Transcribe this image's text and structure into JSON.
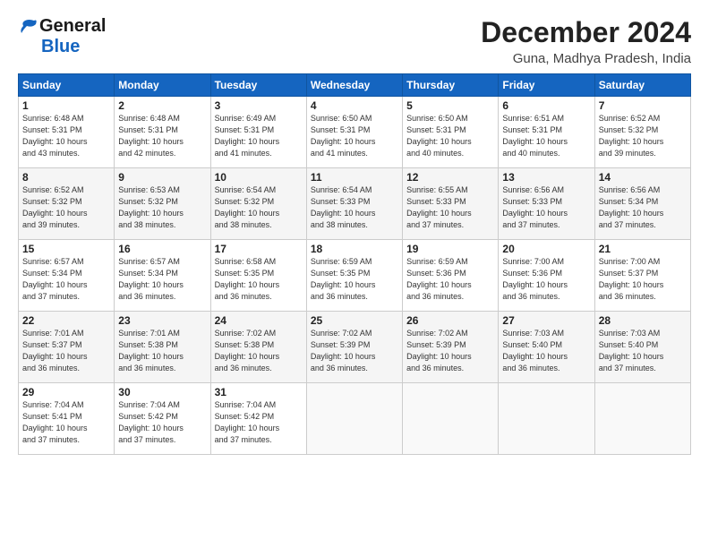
{
  "logo": {
    "line1": "General",
    "line2": "Blue"
  },
  "title": "December 2024",
  "subtitle": "Guna, Madhya Pradesh, India",
  "days_header": [
    "Sunday",
    "Monday",
    "Tuesday",
    "Wednesday",
    "Thursday",
    "Friday",
    "Saturday"
  ],
  "weeks": [
    [
      {
        "day": "1",
        "info": "Sunrise: 6:48 AM\nSunset: 5:31 PM\nDaylight: 10 hours\nand 43 minutes."
      },
      {
        "day": "2",
        "info": "Sunrise: 6:48 AM\nSunset: 5:31 PM\nDaylight: 10 hours\nand 42 minutes."
      },
      {
        "day": "3",
        "info": "Sunrise: 6:49 AM\nSunset: 5:31 PM\nDaylight: 10 hours\nand 41 minutes."
      },
      {
        "day": "4",
        "info": "Sunrise: 6:50 AM\nSunset: 5:31 PM\nDaylight: 10 hours\nand 41 minutes."
      },
      {
        "day": "5",
        "info": "Sunrise: 6:50 AM\nSunset: 5:31 PM\nDaylight: 10 hours\nand 40 minutes."
      },
      {
        "day": "6",
        "info": "Sunrise: 6:51 AM\nSunset: 5:31 PM\nDaylight: 10 hours\nand 40 minutes."
      },
      {
        "day": "7",
        "info": "Sunrise: 6:52 AM\nSunset: 5:32 PM\nDaylight: 10 hours\nand 39 minutes."
      }
    ],
    [
      {
        "day": "8",
        "info": "Sunrise: 6:52 AM\nSunset: 5:32 PM\nDaylight: 10 hours\nand 39 minutes."
      },
      {
        "day": "9",
        "info": "Sunrise: 6:53 AM\nSunset: 5:32 PM\nDaylight: 10 hours\nand 38 minutes."
      },
      {
        "day": "10",
        "info": "Sunrise: 6:54 AM\nSunset: 5:32 PM\nDaylight: 10 hours\nand 38 minutes."
      },
      {
        "day": "11",
        "info": "Sunrise: 6:54 AM\nSunset: 5:33 PM\nDaylight: 10 hours\nand 38 minutes."
      },
      {
        "day": "12",
        "info": "Sunrise: 6:55 AM\nSunset: 5:33 PM\nDaylight: 10 hours\nand 37 minutes."
      },
      {
        "day": "13",
        "info": "Sunrise: 6:56 AM\nSunset: 5:33 PM\nDaylight: 10 hours\nand 37 minutes."
      },
      {
        "day": "14",
        "info": "Sunrise: 6:56 AM\nSunset: 5:34 PM\nDaylight: 10 hours\nand 37 minutes."
      }
    ],
    [
      {
        "day": "15",
        "info": "Sunrise: 6:57 AM\nSunset: 5:34 PM\nDaylight: 10 hours\nand 37 minutes."
      },
      {
        "day": "16",
        "info": "Sunrise: 6:57 AM\nSunset: 5:34 PM\nDaylight: 10 hours\nand 36 minutes."
      },
      {
        "day": "17",
        "info": "Sunrise: 6:58 AM\nSunset: 5:35 PM\nDaylight: 10 hours\nand 36 minutes."
      },
      {
        "day": "18",
        "info": "Sunrise: 6:59 AM\nSunset: 5:35 PM\nDaylight: 10 hours\nand 36 minutes."
      },
      {
        "day": "19",
        "info": "Sunrise: 6:59 AM\nSunset: 5:36 PM\nDaylight: 10 hours\nand 36 minutes."
      },
      {
        "day": "20",
        "info": "Sunrise: 7:00 AM\nSunset: 5:36 PM\nDaylight: 10 hours\nand 36 minutes."
      },
      {
        "day": "21",
        "info": "Sunrise: 7:00 AM\nSunset: 5:37 PM\nDaylight: 10 hours\nand 36 minutes."
      }
    ],
    [
      {
        "day": "22",
        "info": "Sunrise: 7:01 AM\nSunset: 5:37 PM\nDaylight: 10 hours\nand 36 minutes."
      },
      {
        "day": "23",
        "info": "Sunrise: 7:01 AM\nSunset: 5:38 PM\nDaylight: 10 hours\nand 36 minutes."
      },
      {
        "day": "24",
        "info": "Sunrise: 7:02 AM\nSunset: 5:38 PM\nDaylight: 10 hours\nand 36 minutes."
      },
      {
        "day": "25",
        "info": "Sunrise: 7:02 AM\nSunset: 5:39 PM\nDaylight: 10 hours\nand 36 minutes."
      },
      {
        "day": "26",
        "info": "Sunrise: 7:02 AM\nSunset: 5:39 PM\nDaylight: 10 hours\nand 36 minutes."
      },
      {
        "day": "27",
        "info": "Sunrise: 7:03 AM\nSunset: 5:40 PM\nDaylight: 10 hours\nand 36 minutes."
      },
      {
        "day": "28",
        "info": "Sunrise: 7:03 AM\nSunset: 5:40 PM\nDaylight: 10 hours\nand 37 minutes."
      }
    ],
    [
      {
        "day": "29",
        "info": "Sunrise: 7:04 AM\nSunset: 5:41 PM\nDaylight: 10 hours\nand 37 minutes."
      },
      {
        "day": "30",
        "info": "Sunrise: 7:04 AM\nSunset: 5:42 PM\nDaylight: 10 hours\nand 37 minutes."
      },
      {
        "day": "31",
        "info": "Sunrise: 7:04 AM\nSunset: 5:42 PM\nDaylight: 10 hours\nand 37 minutes."
      },
      {
        "day": "",
        "info": ""
      },
      {
        "day": "",
        "info": ""
      },
      {
        "day": "",
        "info": ""
      },
      {
        "day": "",
        "info": ""
      }
    ]
  ]
}
